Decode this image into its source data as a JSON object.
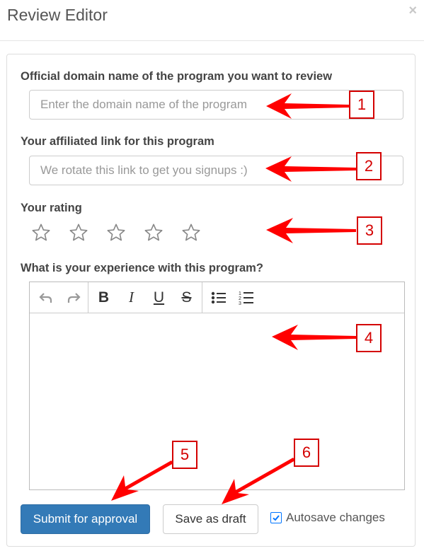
{
  "modal": {
    "title": "Review Editor",
    "close_label": "×"
  },
  "form": {
    "domain": {
      "label": "Official domain name of the program you want to review",
      "placeholder": "Enter the domain name of the program",
      "value": ""
    },
    "link": {
      "label": "Your affiliated link for this program",
      "placeholder": "We rotate this link to get you signups :)",
      "value": ""
    },
    "rating": {
      "label": "Your rating",
      "max_stars": 5,
      "selected": 0
    },
    "experience": {
      "label": "What is your experience with this program?",
      "value": ""
    }
  },
  "toolbar": {
    "undo_icon": "undo-icon",
    "redo_icon": "redo-icon",
    "bold_label": "B",
    "italic_label": "I",
    "underline_label": "U",
    "strike_label": "S",
    "bullet_icon": "bullet-list-icon",
    "numbered_icon": "numbered-list-icon"
  },
  "actions": {
    "submit_label": "Submit for approval",
    "draft_label": "Save as draft",
    "autosave_label": "Autosave changes",
    "autosave_checked": true
  },
  "annotations": {
    "color": "#ff0000",
    "badges": [
      "1",
      "2",
      "3",
      "4",
      "5",
      "6"
    ]
  },
  "colors": {
    "primary": "#337ab7",
    "annotation_border": "#d40000"
  }
}
